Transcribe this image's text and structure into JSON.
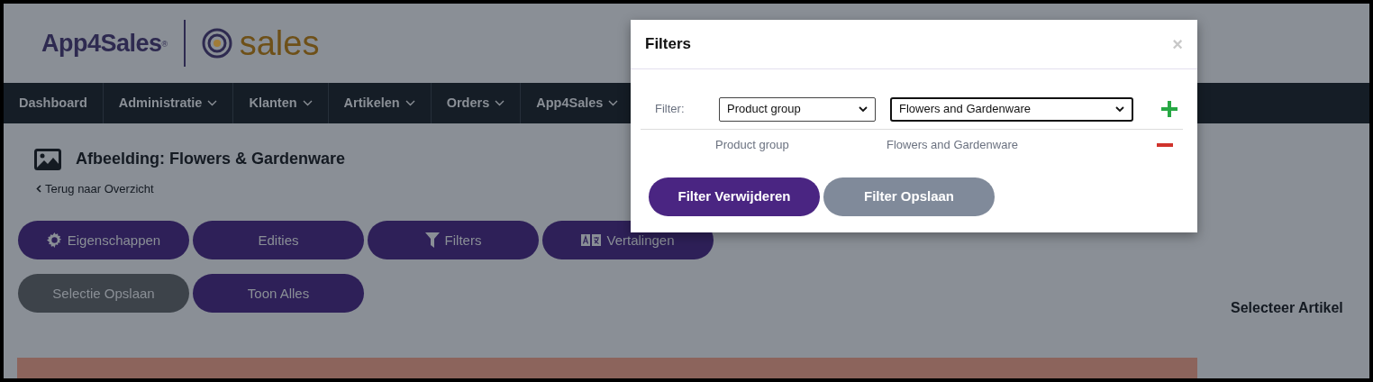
{
  "logo": {
    "brand": "App4Sales",
    "mark": "®",
    "product": "sales"
  },
  "nav": [
    {
      "label": "Dashboard",
      "dropdown": false
    },
    {
      "label": "Administratie",
      "dropdown": true
    },
    {
      "label": "Klanten",
      "dropdown": true
    },
    {
      "label": "Artikelen",
      "dropdown": true
    },
    {
      "label": "Orders",
      "dropdown": true
    },
    {
      "label": "App4Sales",
      "dropdown": true
    }
  ],
  "page": {
    "title": "Afbeelding: Flowers & Gardenware",
    "back_link": "Terug naar Overzicht",
    "side_heading": "Selecteer Artikel"
  },
  "buttons": [
    [
      {
        "label": "Eigenschappen",
        "kind": "gear",
        "disabled": false
      },
      {
        "label": "Edities",
        "kind": "plain",
        "disabled": false
      },
      {
        "label": "Filters",
        "kind": "funnel",
        "disabled": false
      },
      {
        "label": "Vertalingen",
        "kind": "translate",
        "disabled": false
      }
    ],
    [
      {
        "label": "Selectie Opslaan",
        "kind": "plain",
        "disabled": true
      },
      {
        "label": "Toon Alles",
        "kind": "plain",
        "disabled": false
      }
    ]
  ],
  "modal": {
    "title": "Filters",
    "close": "×",
    "filter_label": "Filter:",
    "field_select": "Product group",
    "value_select": "Flowers and Gardenware",
    "active_filters": [
      {
        "field": "Product group",
        "value": "Flowers and Gardenware"
      }
    ],
    "buttons": [
      {
        "label": "Filter Verwijderen",
        "disabled": false
      },
      {
        "label": "Filter Opslaan",
        "disabled": true
      }
    ]
  }
}
